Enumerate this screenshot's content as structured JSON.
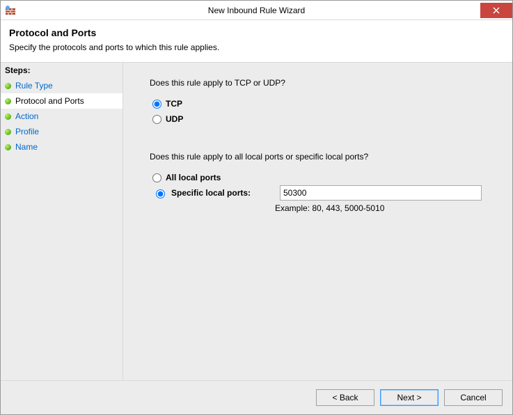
{
  "window": {
    "title": "New Inbound Rule Wizard"
  },
  "header": {
    "title": "Protocol and Ports",
    "subtitle": "Specify the protocols and ports to which this rule applies."
  },
  "sidebar": {
    "steps_label": "Steps:",
    "items": [
      {
        "label": "Rule Type",
        "active": false
      },
      {
        "label": "Protocol and Ports",
        "active": true
      },
      {
        "label": "Action",
        "active": false
      },
      {
        "label": "Profile",
        "active": false
      },
      {
        "label": "Name",
        "active": false
      }
    ]
  },
  "content": {
    "q1": "Does this rule apply to TCP or UDP?",
    "tcp_label": "TCP",
    "udp_label": "UDP",
    "protocol_selected": "tcp",
    "q2": "Does this rule apply to all local ports or specific local ports?",
    "all_ports_label": "All local ports",
    "specific_ports_label": "Specific local ports:",
    "ports_selected": "specific",
    "ports_value": "50300",
    "example": "Example: 80, 443, 5000-5010"
  },
  "footer": {
    "back": "< Back",
    "next": "Next >",
    "cancel": "Cancel"
  }
}
